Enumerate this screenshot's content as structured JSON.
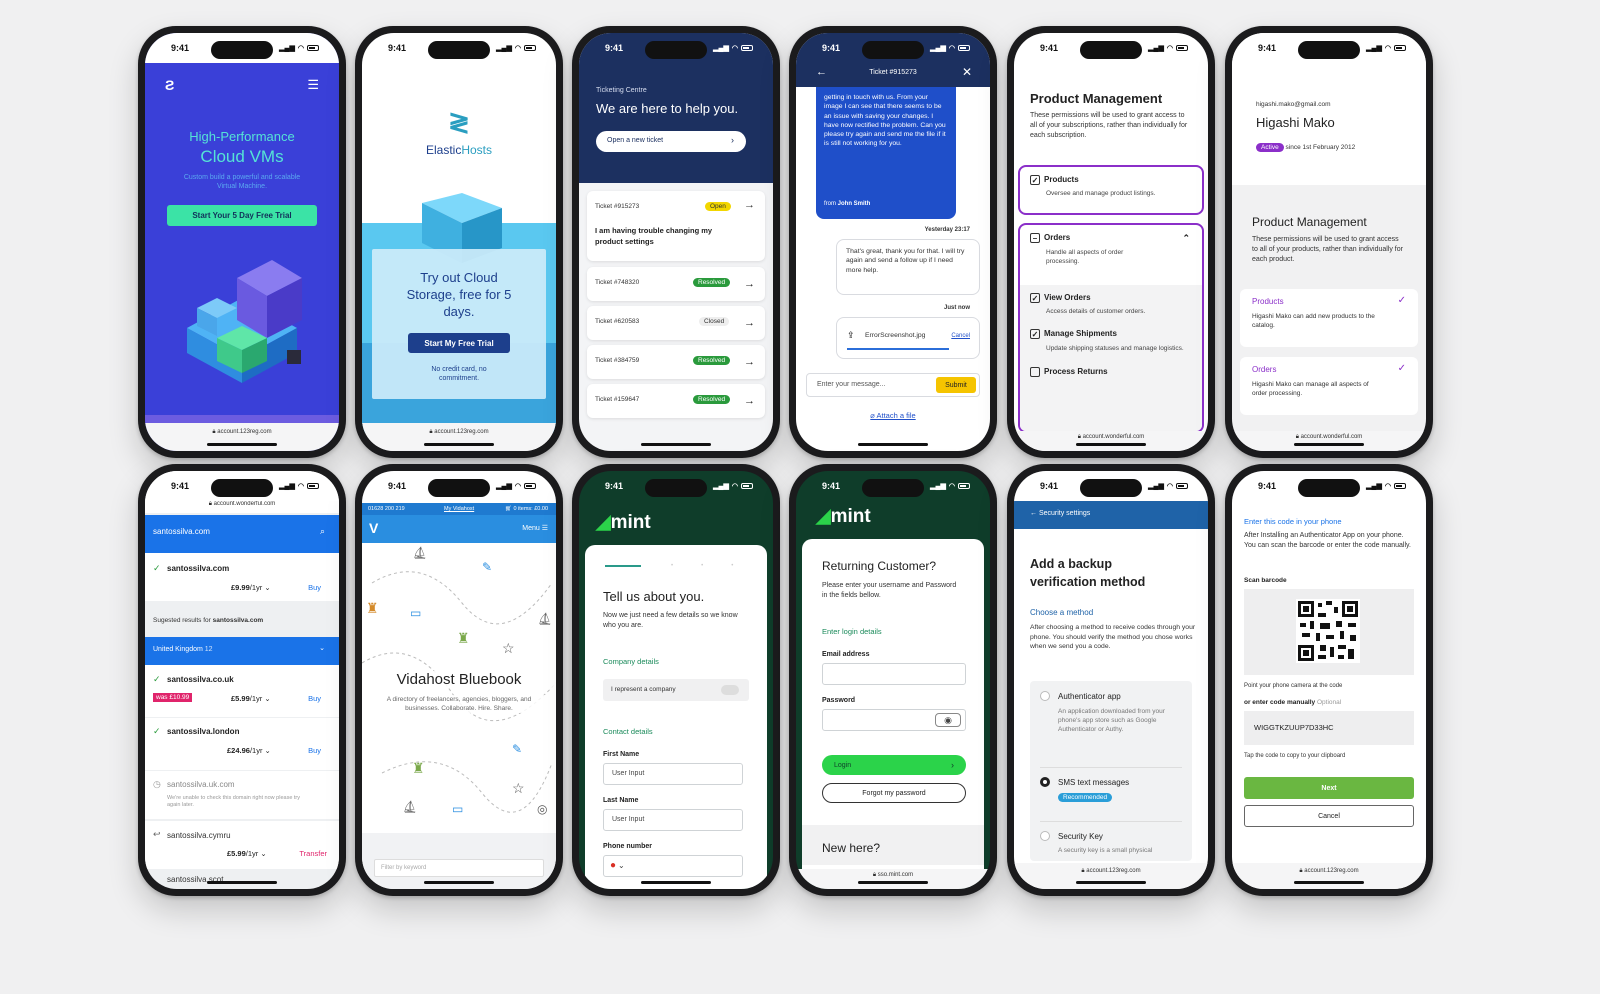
{
  "status_time": "9:41",
  "p1": {
    "title_line1": "High-Performance",
    "title_line2": "Cloud VMs",
    "subtitle": "Custom build a powerful and scalable Virtual Machine.",
    "cta": "Start Your 5 Day Free Trial",
    "url": "account.123reg.com"
  },
  "p2": {
    "brand_a": "Elastic",
    "brand_b": "Hosts",
    "headline": "Try out Cloud Storage, free for 5 days.",
    "cta": "Start My Free Trial",
    "note": "No credit card, no commitment.",
    "url": "account.123reg.com"
  },
  "p3": {
    "kicker": "Ticketing Centre",
    "headline": "We are here to help you.",
    "new_ticket": "Open a new ticket",
    "first_ticket": {
      "id": "Ticket #915273",
      "status": "Open",
      "subject": "I am having trouble changing my product settings"
    },
    "tickets": [
      {
        "id": "Ticket #748320",
        "status": "Resolved"
      },
      {
        "id": "Ticket #620583",
        "status": "Closed"
      },
      {
        "id": "Ticket #384759",
        "status": "Resolved"
      },
      {
        "id": "Ticket #159647",
        "status": "Resolved"
      }
    ]
  },
  "p4": {
    "title": "Ticket #915273",
    "agent_msg": "getting in touch with us. From your image I can see that there seems to be an issue with saving your changes. I have now rectified the problem. Can you please try again and send me the file if it is still not working for you.",
    "from_label": "from",
    "from_name": "John Smith",
    "timestamp1": "Yesterday 23:17",
    "user_msg": "That's great, thank you for that. I will try again and send a follow up if I need more help.",
    "timestamp2": "Just now",
    "file_name": "ErrorScreenshot.jpg",
    "cancel": "Cancel",
    "input_placeholder": "Enter your message...",
    "submit": "Submit",
    "attach": "Attach a file"
  },
  "p5": {
    "title": "Product Management",
    "desc": "These permissions will be used to grant access to all of your subscriptions, rather than individually for each subscription.",
    "items": [
      {
        "name": "Products",
        "desc": "Oversee and manage product listings."
      },
      {
        "name": "Orders",
        "desc": "Handle all aspects of order processing."
      },
      {
        "name": "View Orders",
        "desc": "Access details of customer orders."
      },
      {
        "name": "Manage Shipments",
        "desc": "Update shipping statuses and manage logistics."
      },
      {
        "name": "Process Returns",
        "desc": ""
      }
    ],
    "url": "account.wonderful.com"
  },
  "p6": {
    "email": "higashi.mako@gmail.com",
    "name": "Higashi Mako",
    "badge": "Active",
    "since": "since 1st February 2012",
    "title": "Product Management",
    "desc": "These permissions will be used to grant access to all of your products, rather than individually for each product.",
    "perms": [
      {
        "name": "Products",
        "desc": "Higashi Mako can add new products to the catalog."
      },
      {
        "name": "Orders",
        "desc": "Higashi Mako can manage all aspects of order processing."
      }
    ],
    "url": "account.wonderful.com"
  },
  "p7": {
    "url_top": "account.wonderful.com",
    "search": "santossilva.com",
    "results": [
      {
        "domain": "santossilva.com",
        "price": "£9.99",
        "per": "/1yr",
        "action": "Buy"
      }
    ],
    "suggest_label": "Sugested results for",
    "suggest_domain": "santossilva.com",
    "region": "United Kingdom",
    "region_count": "12",
    "uk": {
      "domain": "santossilva.co.uk",
      "was": "was £10.99",
      "price": "£5.99",
      "per": "/1yr",
      "action": "Buy"
    },
    "london": {
      "domain": "santossilva.london",
      "price": "£24.96",
      "per": "/1yr",
      "action": "Buy"
    },
    "ukcom": {
      "domain": "santossilva.uk.com",
      "note": "We're unable to check this domain right now please try again later."
    },
    "cymru": {
      "domain": "santossilva.cymru",
      "price": "£5.99",
      "per": "/1yr",
      "action": "Transfer"
    },
    "last": "santossilva.scot"
  },
  "p8": {
    "phone": "01628 200 219",
    "account": "My Vidahost",
    "cart": "0 items: £0.00",
    "menu": "Menu",
    "title": "Vidahost Bluebook",
    "subtitle": "A directory of freelancers, agencies, bloggers, and businesses. Collaborate. Hire. Share.",
    "filter": "Filter by keyword"
  },
  "p9": {
    "brand": "mint",
    "title": "Tell us about you.",
    "desc": "Now we just need a few details so we know who you are.",
    "company_section": "Company details",
    "company_toggle": "I represent a company",
    "contact_section": "Contact details",
    "first_label": "First Name",
    "first_val": "User Input",
    "last_label": "Last Name",
    "last_val": "User Input",
    "phone_label": "Phone number"
  },
  "p10": {
    "brand": "mint",
    "title": "Returning Customer?",
    "desc": "Please enter your username and Password in the fields bellow.",
    "section": "Enter login details",
    "email_label": "Email address",
    "password_label": "Password",
    "login": "Login",
    "forgot": "Forgot my password",
    "new_here": "New here?",
    "url": "sso.mint.com"
  },
  "p11": {
    "back_label": "Security settings",
    "title": "Add a backup verification method",
    "choose": "Choose a method",
    "desc": "After choosing a method to receive codes through your phone. You should verify the method you chose works when we send you a code.",
    "options": [
      {
        "name": "Authenticator app",
        "desc": "An application downloaded from your phone's app store such as Google Authenticator or Authy."
      },
      {
        "name": "SMS text messages",
        "badge": "Recommended"
      },
      {
        "name": "Security Key",
        "desc": "A security key is a small physical"
      }
    ],
    "url": "account.123reg.com"
  },
  "p12": {
    "title": "Enter this code in your phone",
    "desc": "After Installing an Authenticator App on your phone. You can scan the barcode or enter the code manually.",
    "scan_label": "Scan barcode",
    "scan_hint": "Point your phone camera at the code",
    "manual_label": "or enter code manually",
    "optional": "Optional",
    "code": "WIGGTKZUUP7D33HC",
    "copy_hint": "Tap the code to copy to your clipboard",
    "next": "Next",
    "cancel": "Cancel",
    "url": "account.123reg.com"
  },
  "colors": {
    "p1_bg": "#3a40d8",
    "p1_cta": "#3be3a6",
    "p3_navy": "#1c3060",
    "p4_blue": "#1f4fc9",
    "p4_submit": "#f5c400",
    "purple": "#8b2fc9",
    "p7_blue": "#1a73e8",
    "mint_green": "#0f3d2a",
    "mint_accent": "#2bd34a",
    "p11_blue": "#1f63a8",
    "p12_green": "#6ab741"
  }
}
